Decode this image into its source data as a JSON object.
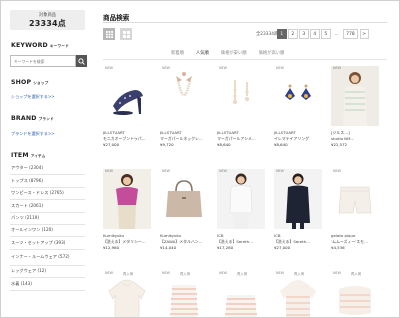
{
  "sidebar": {
    "count_label": "対象商品",
    "count_value": "23334点",
    "keyword_title": "KEYWORD",
    "keyword_sub": "キーワード",
    "keyword_placeholder": "キーワードを検索",
    "shop_title": "SHOP",
    "shop_sub": "ショップ",
    "shop_link": "ショップを選択する>>",
    "brand_title": "BRAND",
    "brand_sub": "ブランド",
    "brand_link": "ブランドを選択する>>",
    "item_title": "ITEM",
    "item_sub": "アイテム",
    "items": [
      {
        "label": "アウター (2304)"
      },
      {
        "label": "トップス (8796)"
      },
      {
        "label": "ワンピース・ドレス (2765)"
      },
      {
        "label": "スカート (2061)"
      },
      {
        "label": "パンツ (2119)"
      },
      {
        "label": "オールインワン (120)"
      },
      {
        "label": "スーツ・セットアップ (393)"
      },
      {
        "label": "インナー・ルームウェア (572)"
      },
      {
        "label": "レッグウェア (12)"
      },
      {
        "label": "水着 (143)"
      }
    ]
  },
  "main": {
    "title": "商品検索",
    "total": "全23334商品",
    "pages": [
      "1",
      "2",
      "3",
      "4",
      "5",
      "...",
      "778",
      ">"
    ],
    "active_page": "1",
    "sorts": [
      "新着順",
      "人気順",
      "価格が安い順",
      "価格が高い順"
    ],
    "active_sort": "人気順"
  },
  "products": [
    {
      "badge": "NEW",
      "badge2": "",
      "brand": "JILLSTUART",
      "name": "モニカオープントゥパ…",
      "price": "¥27,000"
    },
    {
      "badge": "NEW",
      "badge2": "",
      "brand": "JILLSTUART",
      "name": "マーガパールネックレ…",
      "price": "¥9,720"
    },
    {
      "badge": "NEW",
      "badge2": "",
      "brand": "JILLSTUART",
      "name": "マーガパールアシメ…",
      "price": "¥8,640"
    },
    {
      "badge": "NEW",
      "badge2": "",
      "brand": "JILLSTUART",
      "name": "イレマテイアリング",
      "price": "¥8,640"
    },
    {
      "badge": "NEW",
      "badge2": "",
      "brand": "[ジルス…]",
      "name": "studio NM…",
      "price": "¥22,572"
    },
    {
      "badge": "NEW",
      "badge2": "",
      "brand": "Kumikyoku",
      "name": "【洗える】メタリシー…",
      "price": "¥12,960"
    },
    {
      "badge": "NEW",
      "badge2": "",
      "brand": "Kumikyoku",
      "name": "【ZAWA】メタルハン…",
      "price": "¥14,040"
    },
    {
      "badge": "NEW",
      "badge2": "",
      "brand": "ICB",
      "name": "【洗える】Sareth…",
      "price": "¥17,280"
    },
    {
      "badge": "NEW",
      "badge2": "",
      "brand": "ICB",
      "name": "【洗える】Sareth…",
      "price": "¥27,000"
    },
    {
      "badge": "NEW",
      "badge2": "",
      "brand": "gelato pique",
      "name": "'ムムーズィー'スモ…",
      "price": "¥4,536"
    },
    {
      "badge": "NEW",
      "badge2": "再入荷",
      "brand": "",
      "name": "",
      "price": ""
    },
    {
      "badge": "NEW",
      "badge2": "再入荷",
      "brand": "",
      "name": "",
      "price": ""
    },
    {
      "badge": "NEW",
      "badge2": "再入荷",
      "brand": "",
      "name": "",
      "price": ""
    },
    {
      "badge": "NEW",
      "badge2": "再入荷",
      "brand": "",
      "name": "",
      "price": ""
    },
    {
      "badge": "NEW",
      "badge2": "再入荷",
      "brand": "",
      "name": "",
      "price": ""
    }
  ],
  "colors": {
    "link": "#2a5fb0",
    "active_page": "#666666",
    "count_box": "#eeeeee"
  }
}
